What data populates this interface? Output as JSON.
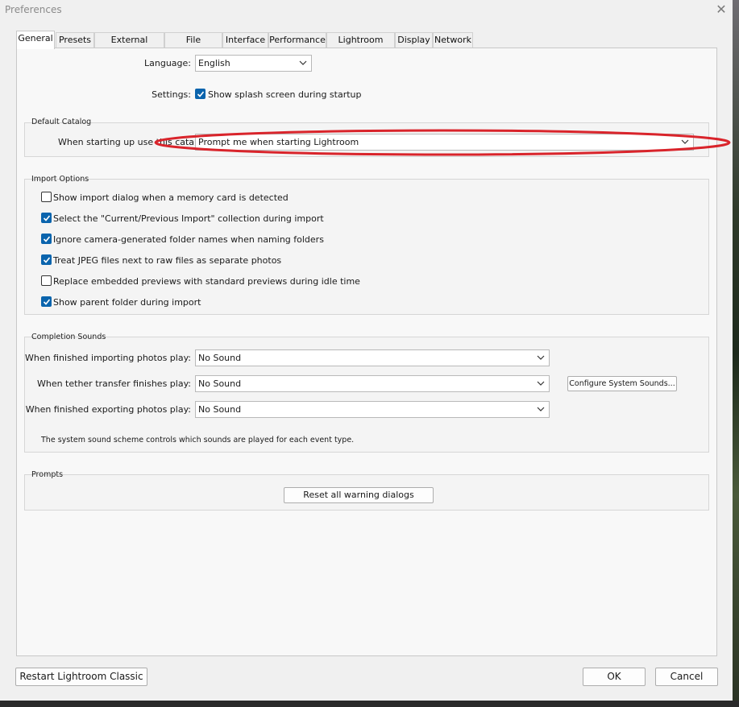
{
  "window": {
    "title": "Preferences",
    "close_glyph": "✕"
  },
  "tabs": [
    {
      "label": "General",
      "active": true
    },
    {
      "label": "Presets"
    },
    {
      "label": "External Editing"
    },
    {
      "label": "File Handling"
    },
    {
      "label": "Interface"
    },
    {
      "label": "Performance"
    },
    {
      "label": "Lightroom Sync"
    },
    {
      "label": "Display"
    },
    {
      "label": "Network"
    }
  ],
  "general": {
    "language_label": "Language:",
    "language_value": "English",
    "settings_label": "Settings:",
    "splash_label": "Show splash screen during startup",
    "splash_checked": true
  },
  "default_catalog": {
    "title": "Default Catalog",
    "startup_label": "When starting up use this catalog:",
    "startup_value": "Prompt me when starting Lightroom",
    "highlight_color": "#d9242b"
  },
  "import_options": {
    "title": "Import Options",
    "items": [
      {
        "label": "Show import dialog when a memory card is detected",
        "checked": false
      },
      {
        "label": "Select the \"Current/Previous Import\" collection during import",
        "checked": true
      },
      {
        "label": "Ignore camera-generated folder names when naming folders",
        "checked": true
      },
      {
        "label": "Treat JPEG files next to raw files as separate photos",
        "checked": true
      },
      {
        "label": "Replace embedded previews with standard previews during idle time",
        "checked": false
      },
      {
        "label": "Show parent folder during import",
        "checked": true
      }
    ]
  },
  "completion_sounds": {
    "title": "Completion Sounds",
    "importing_label": "When finished importing photos play:",
    "importing_value": "No Sound",
    "tether_label": "When tether transfer finishes play:",
    "tether_value": "No Sound",
    "exporting_label": "When finished exporting photos play:",
    "exporting_value": "No Sound",
    "configure_button": "Configure System Sounds...",
    "note": "The system sound scheme controls which sounds are played for each event type."
  },
  "prompts": {
    "title": "Prompts",
    "reset_button": "Reset all warning dialogs"
  },
  "footer": {
    "restart_button": "Restart Lightroom Classic",
    "ok_button": "OK",
    "cancel_button": "Cancel"
  },
  "colors": {
    "checkbox_checked": "#0a64ad",
    "window_bg": "#f0f0f0",
    "panel_bg": "#f8f8f8"
  }
}
